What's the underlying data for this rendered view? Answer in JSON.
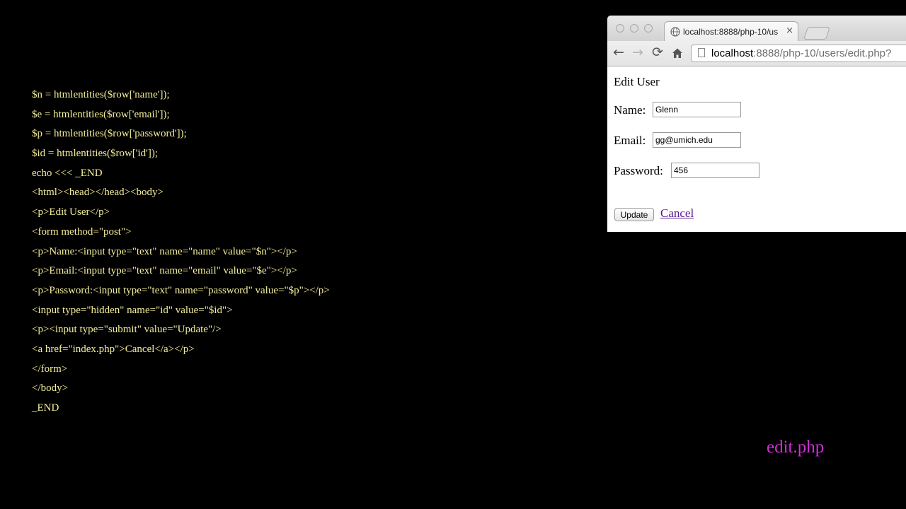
{
  "code_lines": [
    "$n = htmlentities($row['name']);",
    "$e = htmlentities($row['email']);",
    "$p = htmlentities($row['password']);",
    "$id = htmlentities($row['id']);",
    "echo <<< _END",
    "<html><head></head><body>",
    "<p>Edit User</p>",
    "<form method=\"post\">",
    "<p>Name:<input type=\"text\" name=\"name\" value=\"$n\"></p>",
    "<p>Email:<input type=\"text\" name=\"email\" value=\"$e\"></p>",
    "<p>Password:<input type=\"text\" name=\"password\" value=\"$p\"></p>",
    "<input type=\"hidden\" name=\"id\" value=\"$id\">",
    "<p><input type=\"submit\" value=\"Update\"/>",
    "<a href=\"index.php\">Cancel</a></p>",
    "</form>",
    "</body>",
    "_END"
  ],
  "caption": "edit.php",
  "browser": {
    "tab_title": "localhost:8888/php-10/us",
    "tab_close": "×",
    "url_host": "localhost",
    "url_rest": ":8888/php-10/users/edit.php?",
    "icons": {
      "back": "←",
      "forward": "→",
      "reload": "⟳",
      "home": "home-icon",
      "globe": "globe-icon",
      "page": "page-icon"
    }
  },
  "form": {
    "heading": "Edit User",
    "name_label": "Name:",
    "name_value": "Glenn",
    "email_label": "Email:",
    "email_value": "gg@umich.edu",
    "password_label": "Password:",
    "password_value": "456",
    "update_label": "Update",
    "cancel_label": "Cancel"
  },
  "colors": {
    "background": "#000000",
    "code_text": "#f4ee9a",
    "caption": "#d22ed8",
    "visited_link": "#551a8b"
  }
}
